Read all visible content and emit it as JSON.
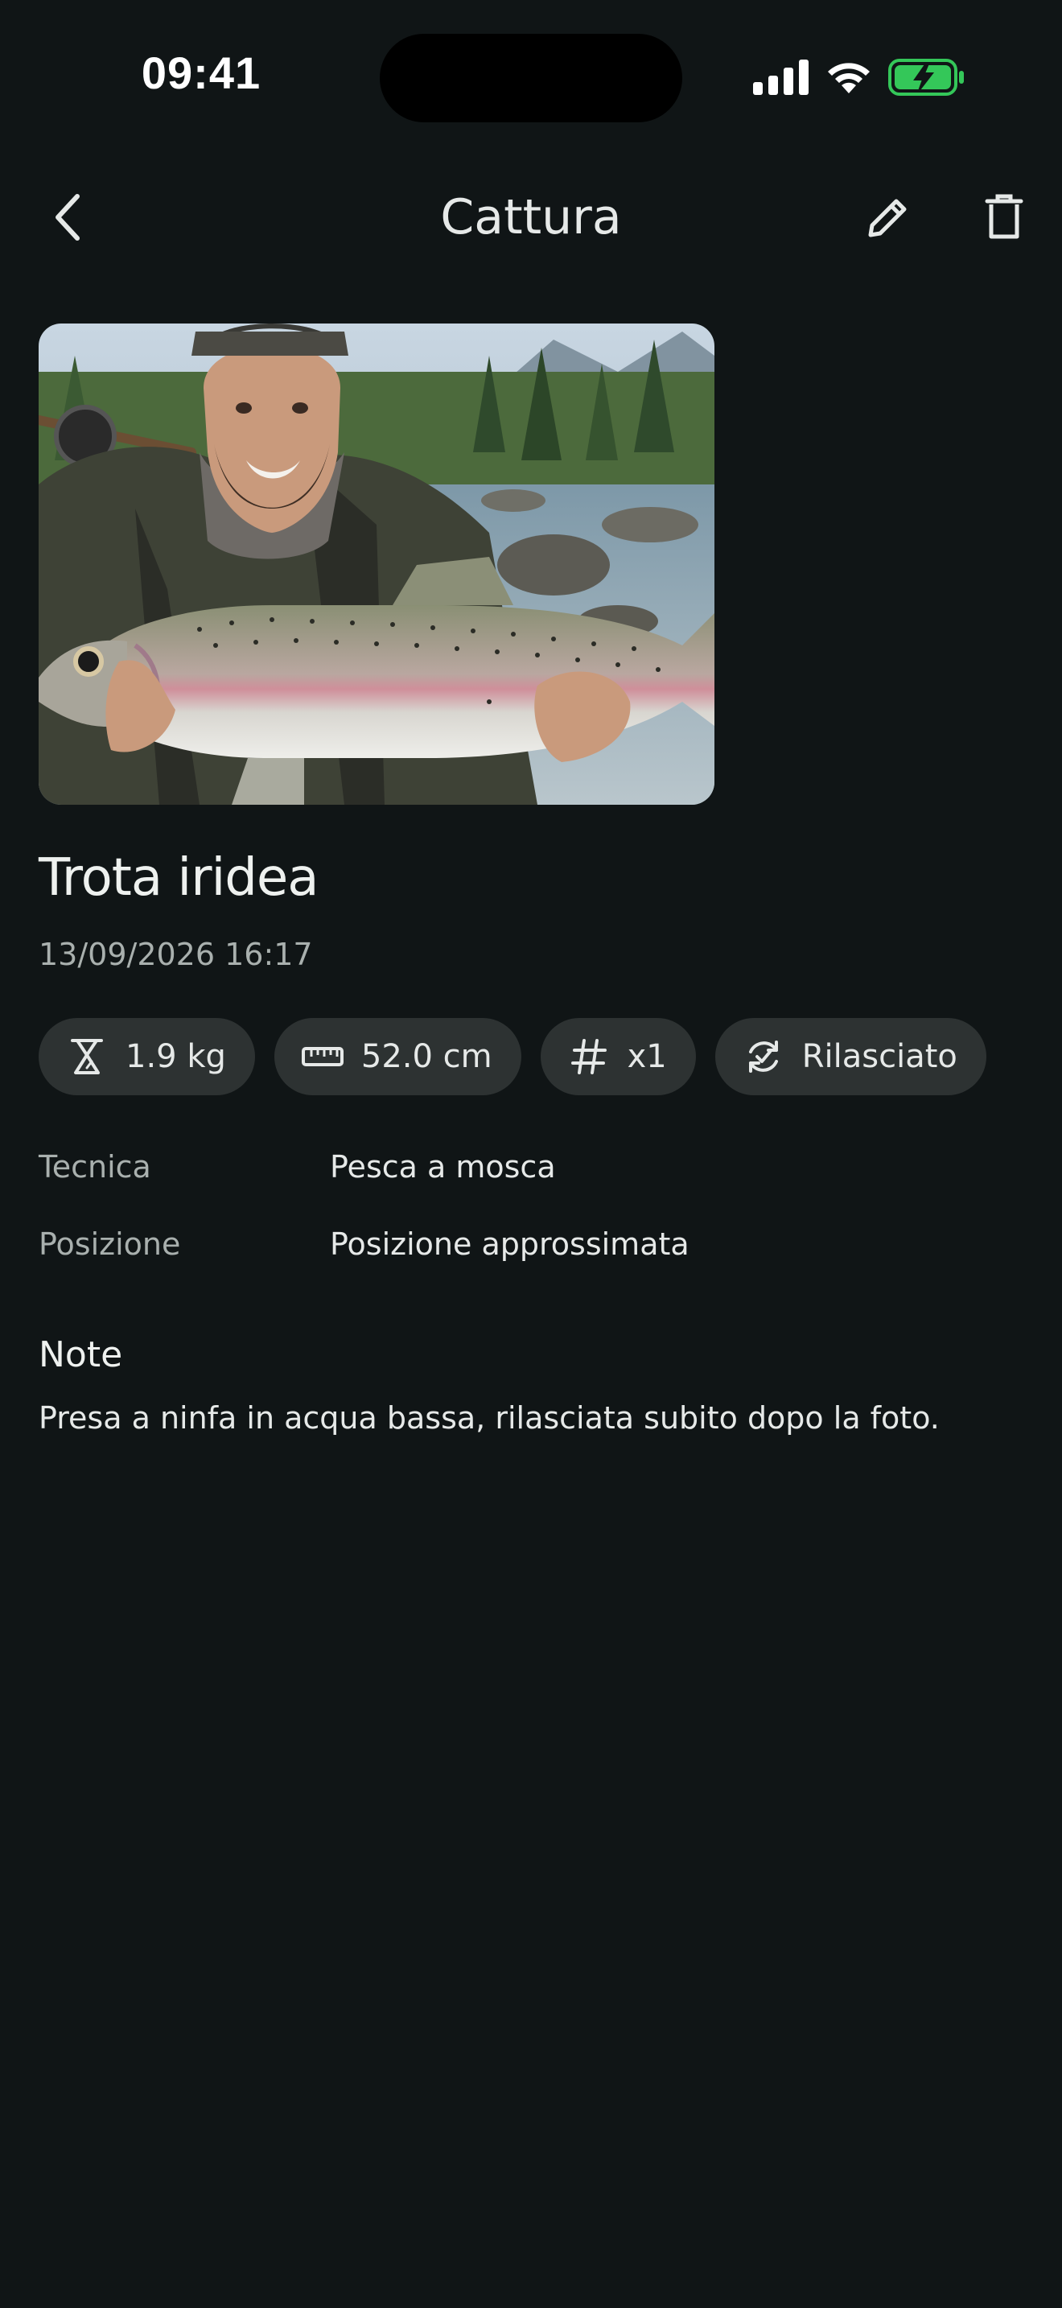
{
  "status_bar": {
    "time": "09:41"
  },
  "nav": {
    "title": "Cattura",
    "back_icon": "chevron-left-icon",
    "edit_icon": "pencil-icon",
    "delete_icon": "trash-icon"
  },
  "catch": {
    "species": "Trota iridea",
    "datetime": "13/09/2026 16:17",
    "chips": [
      {
        "icon": "scale-icon",
        "label": "1.9 kg"
      },
      {
        "icon": "ruler-icon",
        "label": "52.0 cm"
      },
      {
        "icon": "hash-icon",
        "label": "x1"
      },
      {
        "icon": "release-icon",
        "label": "Rilasciato"
      }
    ],
    "details": [
      {
        "label": "Tecnica",
        "value": "Pesca a mosca"
      },
      {
        "label": "Posizione",
        "value": "Posizione approssimata"
      }
    ],
    "notes_heading": "Note",
    "notes": "Presa a ninfa in acqua bassa, rilasciata subito dopo la foto."
  },
  "colors": {
    "background": "#101516",
    "chip_background": "#2d3232",
    "secondary_text": "#a9b0ae",
    "battery_green": "#34c759"
  }
}
